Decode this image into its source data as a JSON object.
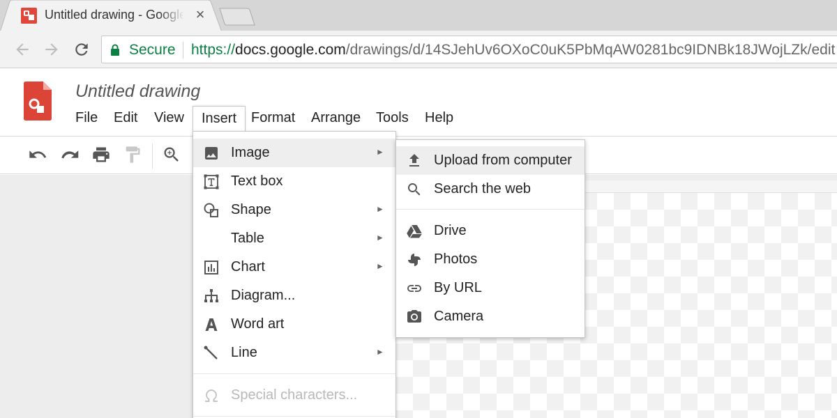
{
  "browser": {
    "tab_title": "Untitled drawing - Google Drawings",
    "tab_close": "×",
    "secure_label": "Secure",
    "url_scheme": "https://",
    "url_host": "docs.google.com",
    "url_path": "/drawings/d/14SJehUv6OXoC0uK5PbMqAW0281bc9IDNBk18JWojLZk/edit"
  },
  "document": {
    "title": "Untitled drawing"
  },
  "menubar": {
    "items": [
      "File",
      "Edit",
      "View",
      "Insert",
      "Format",
      "Arrange",
      "Tools",
      "Help"
    ],
    "active": "Insert"
  },
  "insert_menu": {
    "items": [
      {
        "label": "Image",
        "icon": "image-icon",
        "has_submenu": true,
        "highlighted": true
      },
      {
        "label": "Text box",
        "icon": "text-box-icon",
        "has_submenu": false
      },
      {
        "label": "Shape",
        "icon": "shape-icon",
        "has_submenu": true
      },
      {
        "label": "Table",
        "icon": "",
        "has_submenu": true
      },
      {
        "label": "Chart",
        "icon": "chart-icon",
        "has_submenu": true
      },
      {
        "label": "Diagram...",
        "icon": "diagram-icon",
        "has_submenu": false
      },
      {
        "label": "Word art",
        "icon": "word-art-icon",
        "has_submenu": false
      },
      {
        "label": "Line",
        "icon": "line-icon",
        "has_submenu": true
      },
      {
        "label": "Special characters...",
        "icon": "omega-icon",
        "has_submenu": false,
        "disabled": true
      }
    ],
    "submenu_arrow": "►"
  },
  "image_submenu": {
    "items": [
      {
        "label": "Upload from computer",
        "icon": "upload-icon",
        "highlighted": true
      },
      {
        "label": "Search the web",
        "icon": "search-icon"
      },
      {
        "label": "Drive",
        "icon": "drive-icon"
      },
      {
        "label": "Photos",
        "icon": "photos-icon"
      },
      {
        "label": "By URL",
        "icon": "link-icon"
      },
      {
        "label": "Camera",
        "icon": "camera-icon"
      }
    ]
  },
  "colors": {
    "secure_green": "#0b8043",
    "docs_red": "#db4437",
    "highlight": "#eeeeee"
  }
}
